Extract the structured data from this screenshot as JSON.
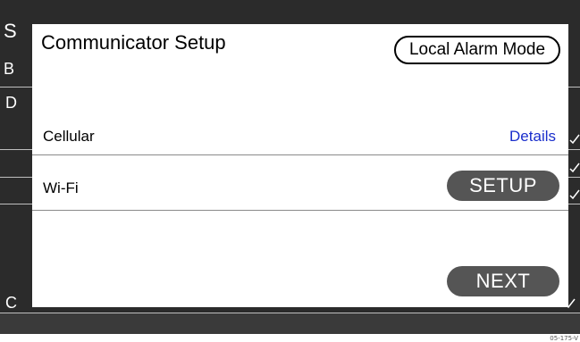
{
  "background": {
    "fragments": [
      "S",
      "B",
      "D",
      "C"
    ]
  },
  "dialog": {
    "title": "Communicator Setup",
    "local_alarm_label": "Local Alarm Mode",
    "rows": [
      {
        "label": "Cellular",
        "action": "Details"
      },
      {
        "label": "Wi-Fi",
        "action": "SETUP"
      }
    ],
    "next_label": "NEXT"
  },
  "footer": {
    "code": "05-175-V"
  },
  "colors": {
    "background": "#2b2b2b",
    "dialog": "#ffffff",
    "button_fill": "#555555",
    "link": "#1a2ecc"
  }
}
